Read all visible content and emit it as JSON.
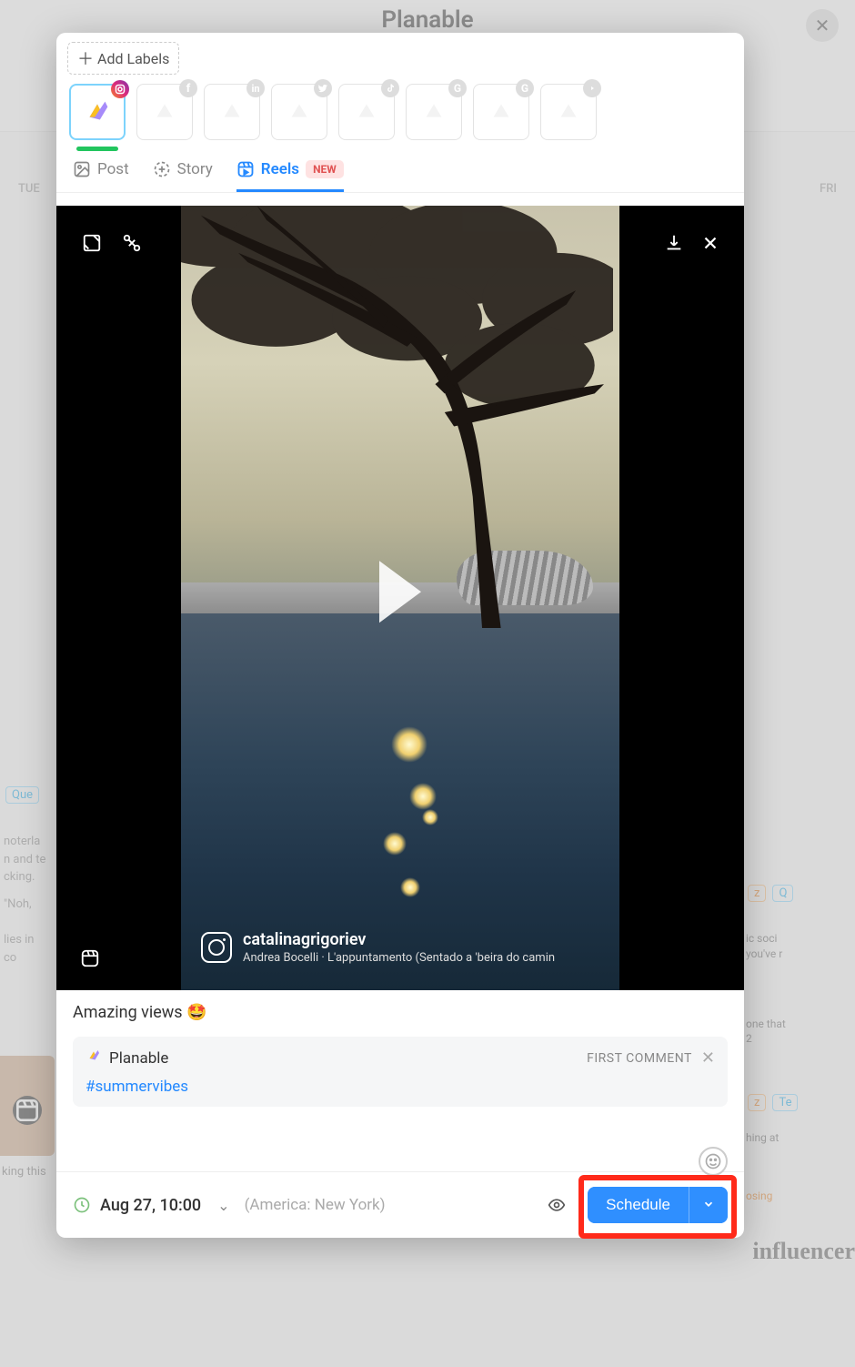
{
  "background": {
    "title": "Planable",
    "days": {
      "left": "TUE",
      "right": "FRI"
    },
    "badges": {
      "que": "Que",
      "z": "z",
      "te": "Te",
      "osing": "osing"
    },
    "left_snips": [
      "noterla",
      "n and te",
      "cking.",
      "\"Noh,",
      "lies in co"
    ],
    "right_snips": [
      "ic soci",
      "you've r",
      "one that",
      "2",
      "hing at"
    ],
    "bottom_left": "king this",
    "influencer": "influencer"
  },
  "modal": {
    "add_labels": "Add Labels",
    "accounts": [
      {
        "network": "instagram",
        "selected": true
      },
      {
        "network": "facebook",
        "selected": false
      },
      {
        "network": "linkedin",
        "selected": false
      },
      {
        "network": "twitter",
        "selected": false
      },
      {
        "network": "tiktok",
        "selected": false
      },
      {
        "network": "google",
        "selected": false
      },
      {
        "network": "google",
        "selected": false
      },
      {
        "network": "youtube",
        "selected": false
      }
    ],
    "tabs": {
      "post": "Post",
      "story": "Story",
      "reels": "Reels",
      "new_badge": "NEW"
    },
    "video": {
      "username": "catalinagrigoriev",
      "song": "Andrea Bocelli · L'appuntamento (Sentado a 'beira do camin"
    },
    "caption": "Amazing views 🤩",
    "first_comment": {
      "brand": "Planable",
      "label": "FIRST COMMENT",
      "hashtag": "#summervibes"
    },
    "footer": {
      "datetime": "Aug 27, 10:00",
      "timezone": "(America: New York)",
      "schedule": "Schedule"
    }
  }
}
